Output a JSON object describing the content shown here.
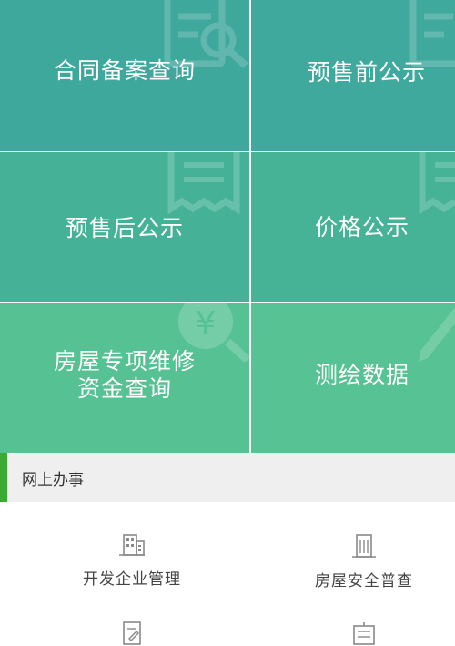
{
  "tiles": [
    {
      "label": "合同备案查询",
      "icon": "document-search-icon"
    },
    {
      "label": "预售前公示",
      "icon": "document-search-icon"
    },
    {
      "label": "预售后公示",
      "icon": "receipt-icon"
    },
    {
      "label": "价格公示",
      "icon": "receipt-icon"
    },
    {
      "label_line1": "房屋专项维修",
      "label_line2": "资金查询",
      "icon": "yen-search-icon"
    },
    {
      "label": "测绘数据",
      "icon": "pencil-icon"
    }
  ],
  "section": {
    "title": "网上办事",
    "accent_color": "#3aaa35"
  },
  "services": [
    {
      "label": "开发企业管理",
      "icon": "building-icon"
    },
    {
      "label": "房屋安全普查",
      "icon": "tall-building-icon"
    },
    {
      "icon": "document-edit-icon"
    },
    {
      "icon": "building-icon"
    }
  ]
}
